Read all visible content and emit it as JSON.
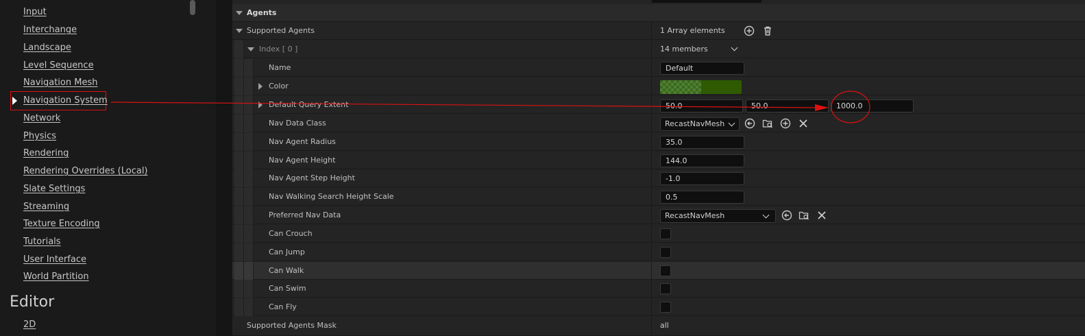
{
  "sidebar": {
    "items": [
      {
        "label": "Input"
      },
      {
        "label": "Interchange"
      },
      {
        "label": "Landscape"
      },
      {
        "label": "Level Sequence"
      },
      {
        "label": "Navigation Mesh"
      },
      {
        "label": "Navigation System"
      },
      {
        "label": "Network"
      },
      {
        "label": "Physics"
      },
      {
        "label": "Rendering"
      },
      {
        "label": "Rendering Overrides (Local)"
      },
      {
        "label": "Slate Settings"
      },
      {
        "label": "Streaming"
      },
      {
        "label": "Texture Encoding"
      },
      {
        "label": "Tutorials"
      },
      {
        "label": "User Interface"
      },
      {
        "label": "World Partition"
      }
    ],
    "section_heading": "Editor",
    "section_items": [
      {
        "label": "2D"
      }
    ],
    "selected": "Navigation System"
  },
  "details": {
    "category": "Agents",
    "supported_agents": {
      "label": "Supported Agents",
      "value": "1 Array elements"
    },
    "index": {
      "label": "Index [ 0 ]",
      "value": "14 members"
    },
    "props": {
      "name": {
        "label": "Name",
        "value": "Default"
      },
      "color": {
        "label": "Color",
        "value": "#2f5a00"
      },
      "query_extent": {
        "label": "Default Query Extent",
        "x": "50.0",
        "y": "50.0",
        "z": "1000.0"
      },
      "nav_data_class": {
        "label": "Nav Data Class",
        "value": "RecastNavMesh"
      },
      "radius": {
        "label": "Nav Agent Radius",
        "value": "35.0"
      },
      "height": {
        "label": "Nav Agent Height",
        "value": "144.0"
      },
      "step_height": {
        "label": "Nav Agent Step Height",
        "value": "-1.0"
      },
      "walk_scale": {
        "label": "Nav Walking Search Height Scale",
        "value": "0.5"
      },
      "preferred": {
        "label": "Preferred Nav Data",
        "value": "RecastNavMesh"
      },
      "can_crouch": {
        "label": "Can Crouch",
        "checked": false
      },
      "can_jump": {
        "label": "Can Jump",
        "checked": false
      },
      "can_walk": {
        "label": "Can Walk",
        "checked": false
      },
      "can_swim": {
        "label": "Can Swim",
        "checked": false
      },
      "can_fly": {
        "label": "Can Fly",
        "checked": false
      }
    },
    "mask": {
      "label": "Supported Agents Mask",
      "value": "all"
    }
  },
  "annotation_color": "#dd1111"
}
